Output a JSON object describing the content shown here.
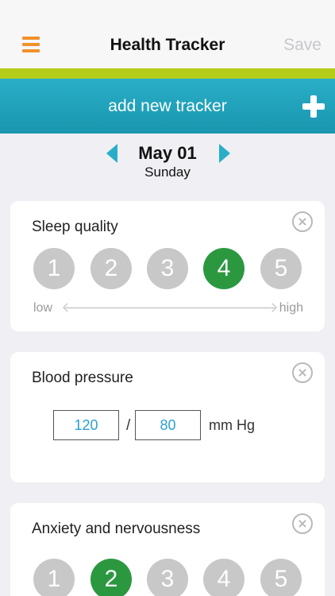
{
  "nav": {
    "title": "Health Tracker",
    "save_label": "Save",
    "menu_icon": "hamburger-menu-icon"
  },
  "add_tracker": {
    "label": "add new tracker",
    "icon": "plus-icon"
  },
  "date": {
    "day": "May 01",
    "weekday": "Sunday"
  },
  "trackers": [
    {
      "title": "Sleep quality",
      "type": "rating",
      "options": [
        "1",
        "2",
        "3",
        "4",
        "5"
      ],
      "selected": "4",
      "scale_low": "low",
      "scale_high": "high"
    },
    {
      "title": "Blood pressure",
      "type": "blood-pressure",
      "systolic": "120",
      "separator": "/",
      "diastolic": "80",
      "unit": "mm Hg"
    },
    {
      "title": "Anxiety and nervousness",
      "type": "rating",
      "options": [
        "1",
        "2",
        "3",
        "4",
        "5"
      ],
      "selected": "2"
    }
  ],
  "colors": {
    "accent_orange": "#f0922b",
    "lime_bar": "#b5cc18",
    "teal": "#2aaec8",
    "selected_green": "#2b9840",
    "unselected_gray": "#c8c8c8",
    "input_value_blue": "#2b9fd4"
  }
}
